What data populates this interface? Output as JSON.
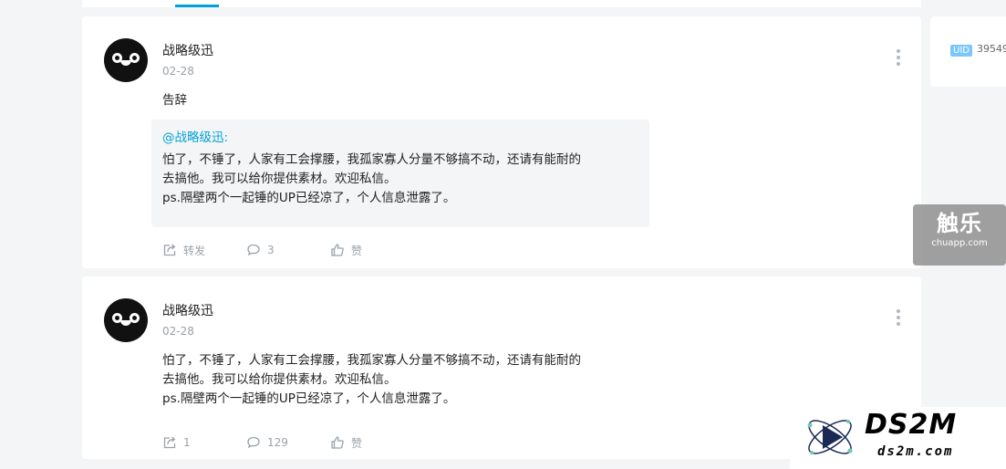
{
  "posts": [
    {
      "username": "战略级迅",
      "date": "02-28",
      "text": "告辞",
      "quote": {
        "mention": "@战略级迅:",
        "text": "怕了，不锤了，人家有工会撑腰，我孤家寡人分量不够搞不动，还请有能耐的\n去搞他。我可以给你提供素材。欢迎私信。\nps.隔壁两个一起锤的UP已经凉了，个人信息泄露了。"
      },
      "actions": {
        "share": "转发",
        "comments": "3",
        "like": "赞"
      }
    },
    {
      "username": "战略级迅",
      "date": "02-28",
      "text": "怕了，不锤了，人家有工会撑腰，我孤家寡人分量不够搞不动，还请有能耐的\n去搞他。我可以给你提供素材。欢迎私信。\nps.隔壁两个一起锤的UP已经凉了，个人信息泄露了。",
      "actions": {
        "share": "1",
        "comments": "129",
        "like": "赞"
      }
    }
  ],
  "sidebar": {
    "uid_label": "UID",
    "uid_value": "39549"
  },
  "watermarks": {
    "chuapp_big": "触乐",
    "chuapp_small": "chuapp.com",
    "ds2m_big": "DS2M",
    "ds2m_small": "ds2m.com"
  },
  "colors": {
    "accent": "#00a1d6",
    "muted": "#99a2aa",
    "uid_badge": "#7ac6ff"
  }
}
